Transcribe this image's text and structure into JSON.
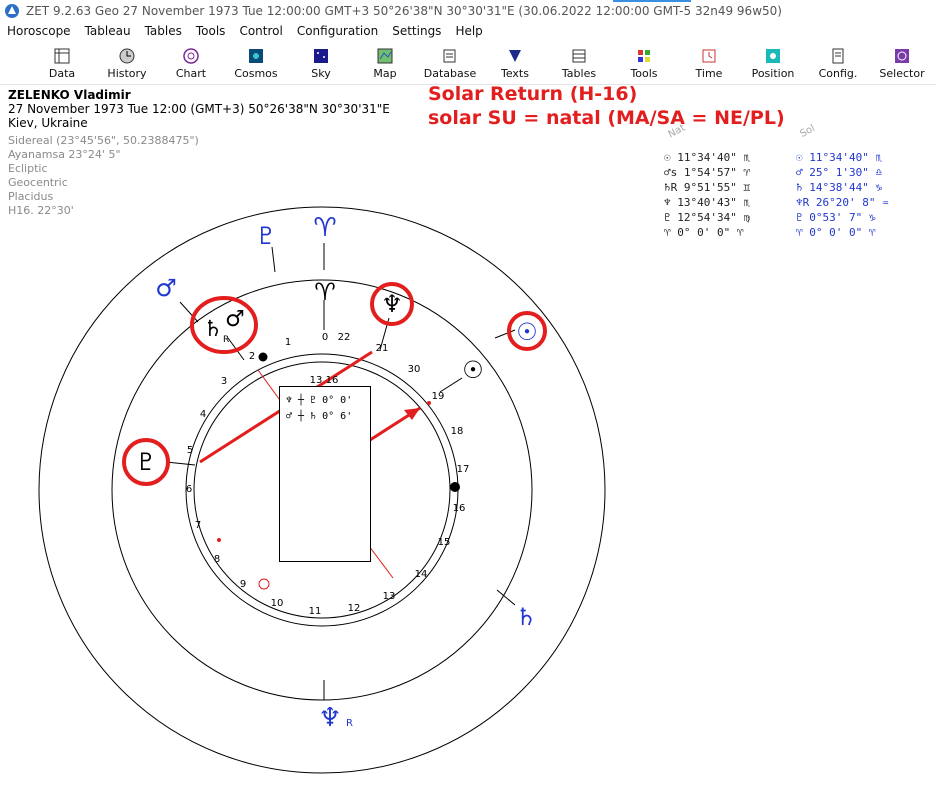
{
  "window": {
    "title": "ZET 9.2.63 Geo   27 November 1973   Tue   12:00:00 GMT+3 50°26'38\"N  30°30'31\"E   (30.06.2022  12:00:00 GMT-5 32n49 96w50)"
  },
  "menu": [
    "Horoscope",
    "Tableau",
    "Tables",
    "Tools",
    "Control",
    "Configuration",
    "Settings",
    "Help"
  ],
  "toolbar": [
    {
      "label": "Data",
      "icon": "data-icon"
    },
    {
      "label": "History",
      "icon": "history-icon"
    },
    {
      "label": "Chart",
      "icon": "chart-icon"
    },
    {
      "label": "Cosmos",
      "icon": "cosmos-icon"
    },
    {
      "label": "Sky",
      "icon": "sky-icon"
    },
    {
      "label": "Map",
      "icon": "map-icon"
    },
    {
      "label": "Database",
      "icon": "database-icon"
    },
    {
      "label": "Texts",
      "icon": "texts-icon"
    },
    {
      "label": "Tables",
      "icon": "tables-icon"
    },
    {
      "label": "Tools",
      "icon": "tools-icon"
    },
    {
      "label": "Time",
      "icon": "time-icon"
    },
    {
      "label": "Position",
      "icon": "position-icon"
    },
    {
      "label": "Config.",
      "icon": "config-icon"
    },
    {
      "label": "Selector",
      "icon": "selector-icon"
    }
  ],
  "person": {
    "name": "ZELENKO Vladimir",
    "datetime": "27 November 1973  Tue  12:00 (GMT+3) 50°26'38\"N  30°30'31\"E",
    "place": "Kiev, Ukraine",
    "settings": [
      "Sidereal (23°45'56\", 50.2388475\")",
      "Ayanamsa 23°24' 5\"",
      "Ecliptic",
      "Geocentric",
      "Placidus",
      "H16. 22°30'"
    ]
  },
  "annotation": {
    "line1": "Solar Return (H-16)",
    "line2": "solar SU = natal (MA/SA = NE/PL)"
  },
  "table_headers": {
    "natal": "Nat",
    "solar": "Sol"
  },
  "positions": [
    {
      "natal": "☉    11°34'40\" ♏",
      "solar": "☉   11°34'40\" ♏"
    },
    {
      "natal": "♂s   1°54'57\" ♈",
      "solar": "♂   25° 1'30\" ♎"
    },
    {
      "natal": "♄R   9°51'55\" ♊",
      "solar": "♄   14°38'44\" ♑"
    },
    {
      "natal": "♆   13°40'43\" ♏",
      "solar": "♆R  26°20' 8\" ♒"
    },
    {
      "natal": "♇   12°54'34\" ♍",
      "solar": "♇    0°53' 7\" ♑"
    },
    {
      "natal": "♈    0° 0' 0\" ♈",
      "solar": "♈    0° 0' 0\" ♈"
    }
  ],
  "aspect_box": {
    "top_label": "13 16",
    "rows": [
      {
        "text": "♆ ┼ ♇    0° 0'"
      },
      {
        "text": "♂ ┼ ♄    0° 6'"
      }
    ]
  },
  "outer_glyphs": [
    {
      "glyph": "♇",
      "color": "#2036d0"
    },
    {
      "glyph": "♈",
      "color": "#2036d0"
    },
    {
      "glyph": "♂",
      "color": "#2036d0"
    },
    {
      "glyph": "☉",
      "color": "#2036d0"
    },
    {
      "glyph": "♄",
      "color": "#2036d0"
    },
    {
      "glyph": "♆",
      "sub": "R",
      "color": "#2036d0"
    }
  ],
  "middle_glyphs": [
    {
      "glyph": "♈",
      "color": "#000000"
    },
    {
      "glyph": "♆",
      "color": "#000000"
    },
    {
      "glyph": "☉",
      "color": "#000000"
    },
    {
      "glyph": "♄",
      "sub": "R",
      "color": "#000000"
    },
    {
      "glyph": "♂",
      "color": "#000000"
    },
    {
      "glyph": "♇",
      "color": "#000000"
    }
  ],
  "harmonic_ticks": [
    "0",
    "22",
    "1",
    "21",
    "2",
    "3",
    "30",
    "19",
    "4",
    "18",
    "5",
    "17",
    "6",
    "16",
    "7",
    "15",
    "8",
    "14",
    "9",
    "13",
    "10",
    "11",
    "12"
  ],
  "colors": {
    "accent_red": "#e31e1e",
    "solar_blue": "#2036d0"
  }
}
